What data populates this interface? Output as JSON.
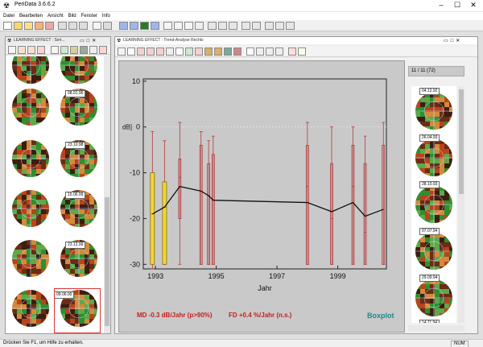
{
  "window": {
    "title": "PeriData 3.6.6.2",
    "minimize": "–",
    "maximize": "☐",
    "close": "✕"
  },
  "menu": [
    "Datei",
    "Bearbeiten",
    "Ansicht",
    "Bild",
    "Fenster",
    "Info"
  ],
  "left_panel": {
    "title": "LEARNING EFFECT : Seri...",
    "dates": [
      "08.01.96",
      "23.10.98",
      "15.06.99",
      "23.12.99",
      "09.06.00"
    ]
  },
  "trend_panel": {
    "title": "LEARNING EFFECT : Trend-Analyse Rechts",
    "counter": "11 / 11  (72)",
    "side_dates": [
      "04.12.92",
      "26.04.93",
      "28.10.93",
      "07.07.94",
      "29.09.94",
      "14.11.94"
    ],
    "md_text": "MD -0.3 dB/Jahr (p>90%)",
    "fd_text": "FD +0.4 %/Jahr (n.s.)",
    "boxplot_label": "Boxplot",
    "colors": {
      "md_text": "#c81e1e",
      "fd_text": "#c81e1e",
      "boxplot_label": "#1a8a8a",
      "yellow_box": "#f3d832",
      "red_box": "#b33a3a"
    }
  },
  "chart_data": {
    "type": "box",
    "ylabel": "dB]",
    "xlabel": "Jahr",
    "x_ticks": [
      "1993",
      "1995",
      "1997",
      "1999"
    ],
    "y_ticks": [
      "10",
      "0",
      "-10",
      "-20",
      "-30"
    ],
    "xlim": [
      1992.6,
      2000.6
    ],
    "ylim": [
      -31,
      10.5
    ],
    "trend_line": [
      {
        "x": 1992.9,
        "y": -19
      },
      {
        "x": 1993.3,
        "y": -17.5
      },
      {
        "x": 1993.8,
        "y": -13
      },
      {
        "x": 1994.5,
        "y": -14
      },
      {
        "x": 1994.75,
        "y": -15
      },
      {
        "x": 1994.9,
        "y": -16
      },
      {
        "x": 1998.0,
        "y": -16.5
      },
      {
        "x": 1998.8,
        "y": -18.5
      },
      {
        "x": 1999.5,
        "y": -16.5
      },
      {
        "x": 1999.9,
        "y": -19.5
      },
      {
        "x": 2000.5,
        "y": -18
      }
    ],
    "boxes": [
      {
        "x": 1992.9,
        "lo": -31,
        "q1": -30,
        "med": -19,
        "q3": -10,
        "hi": -1,
        "color": "yellow"
      },
      {
        "x": 1993.3,
        "lo": -30,
        "q1": -30,
        "med": -17.5,
        "q3": -12,
        "hi": -3,
        "color": "yellow"
      },
      {
        "x": 1993.8,
        "lo": -30,
        "q1": -20,
        "med": -11,
        "q3": -7,
        "hi": 1,
        "color": "red"
      },
      {
        "x": 1994.5,
        "lo": -30,
        "q1": -30,
        "med": -14,
        "q3": -4,
        "hi": -1,
        "color": "red"
      },
      {
        "x": 1994.75,
        "lo": -30,
        "q1": -30,
        "med": -15,
        "q3": -8,
        "hi": -3,
        "color": "red"
      },
      {
        "x": 1994.9,
        "lo": -30,
        "q1": -30,
        "med": -16,
        "q3": -6,
        "hi": -2,
        "color": "red"
      },
      {
        "x": 1998.0,
        "lo": -30,
        "q1": -30,
        "med": -13,
        "q3": -4,
        "hi": 1,
        "color": "red"
      },
      {
        "x": 1998.8,
        "lo": -30,
        "q1": -30,
        "med": -20,
        "q3": -8,
        "hi": 0,
        "color": "red"
      },
      {
        "x": 1999.5,
        "lo": -30,
        "q1": -30,
        "med": -13,
        "q3": -4,
        "hi": 0,
        "color": "red"
      },
      {
        "x": 1999.9,
        "lo": -30,
        "q1": -30,
        "med": -23,
        "q3": -8,
        "hi": -2,
        "color": "red"
      },
      {
        "x": 2000.5,
        "lo": -30,
        "q1": -30,
        "med": -18,
        "q3": -4,
        "hi": 1,
        "color": "red"
      }
    ]
  },
  "status": {
    "text": "Drücken Sie F1, um Hilfe zu erhalten.",
    "num": "NUM"
  }
}
